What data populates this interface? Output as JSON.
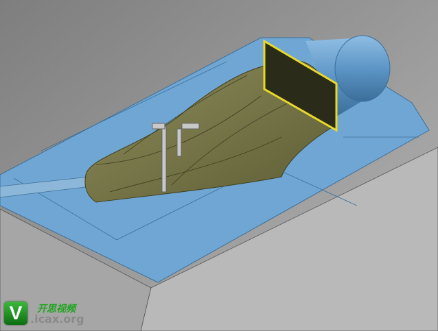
{
  "watermark": {
    "logo_letter": "V",
    "brand_name": "开思视频",
    "brand_url": ".icax.org"
  },
  "colors": {
    "background": "#9a9a9a",
    "plate": "#6fa6d3",
    "part": "#7b7a4a",
    "frame": "#e8d92a"
  }
}
